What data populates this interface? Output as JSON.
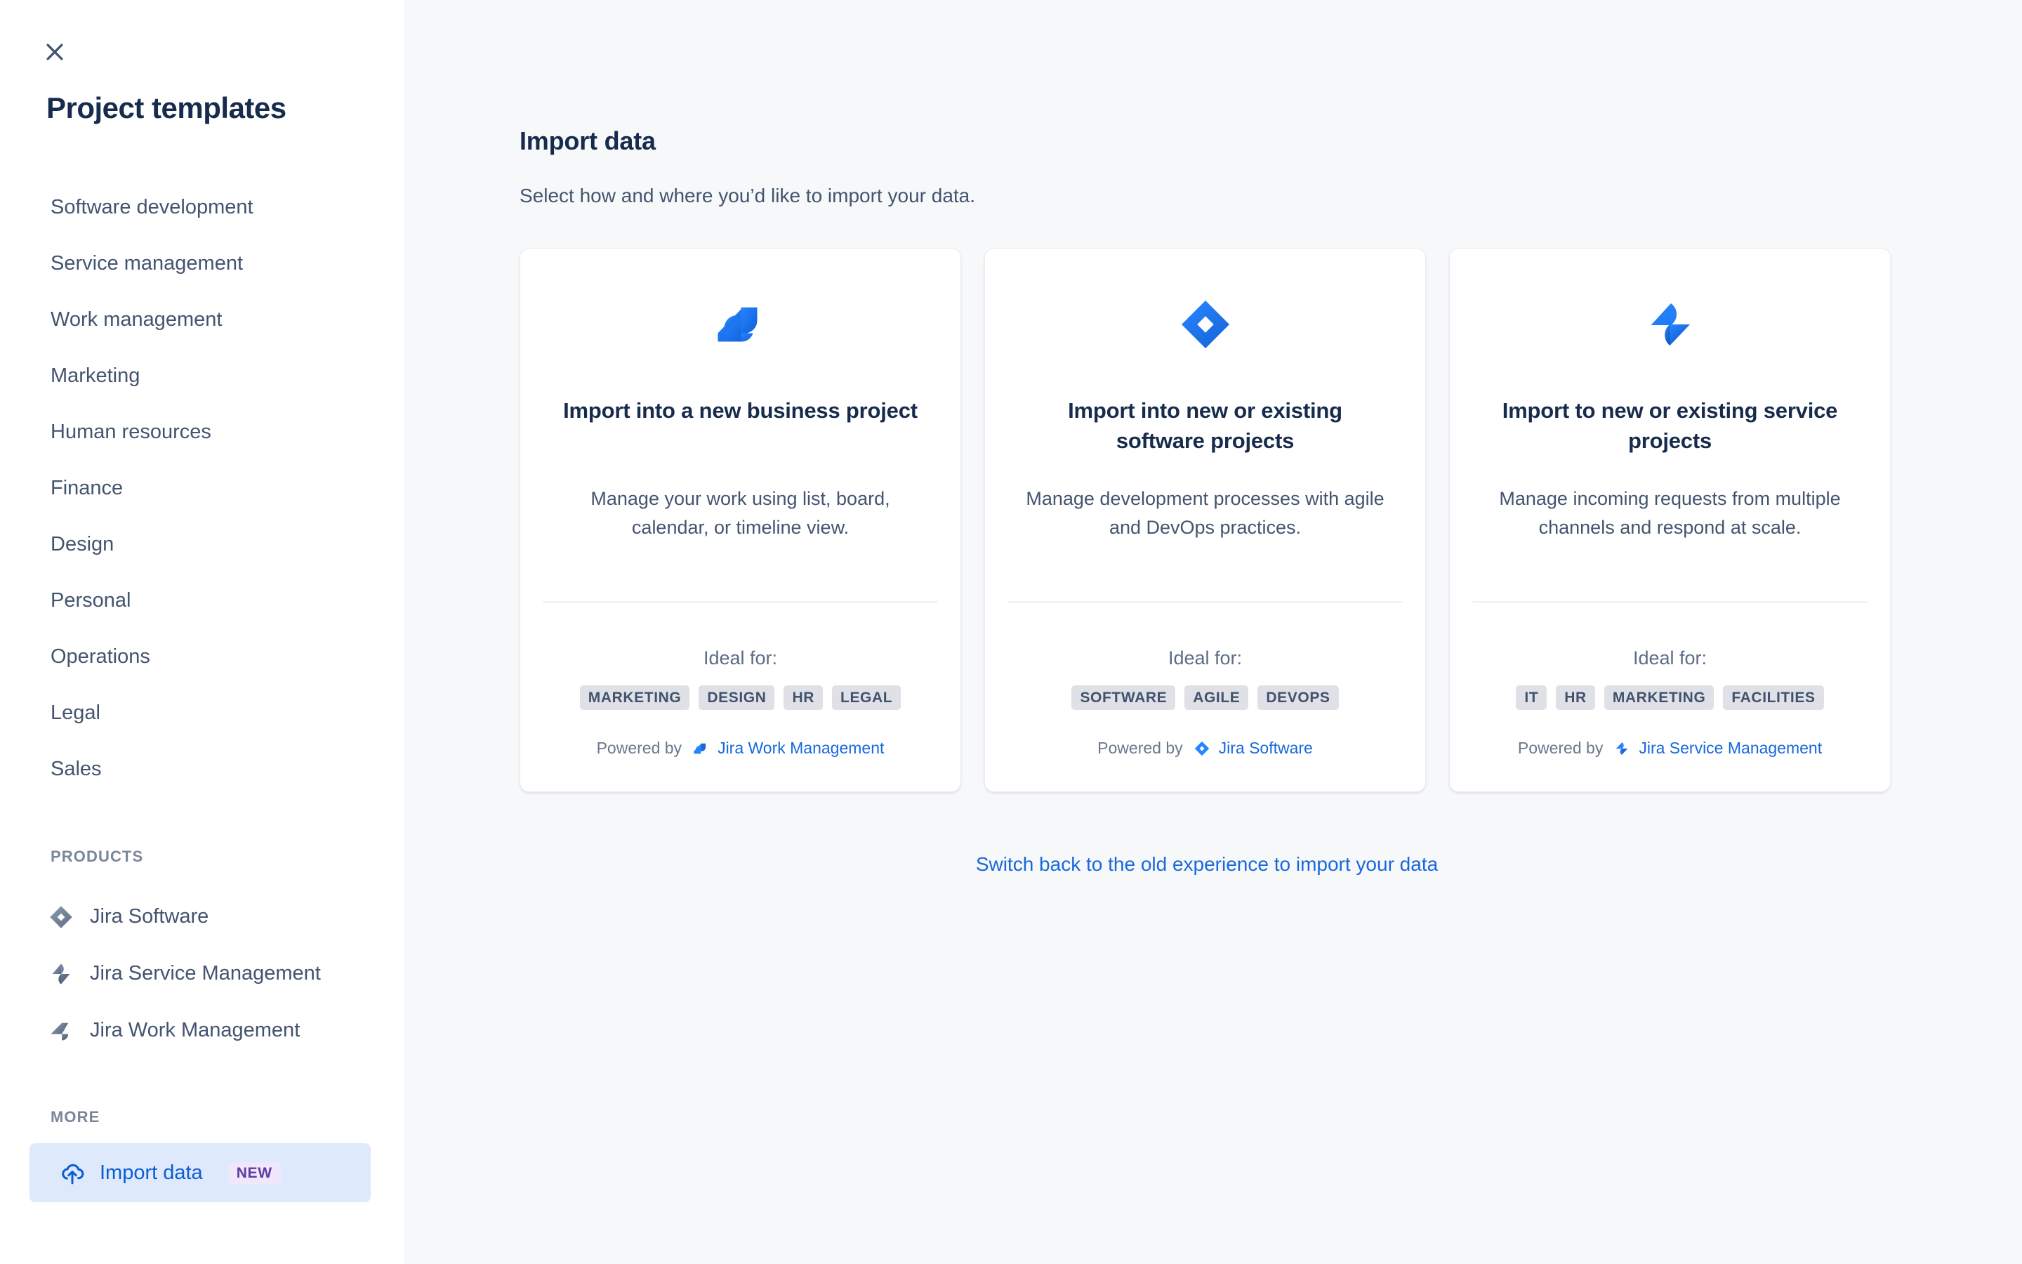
{
  "sidebar": {
    "close_icon": "close-icon",
    "title": "Project templates",
    "nav_items": [
      {
        "label": "Software development"
      },
      {
        "label": "Service management"
      },
      {
        "label": "Work management"
      },
      {
        "label": "Marketing"
      },
      {
        "label": "Human resources"
      },
      {
        "label": "Finance"
      },
      {
        "label": "Design"
      },
      {
        "label": "Personal"
      },
      {
        "label": "Operations"
      },
      {
        "label": "Legal"
      },
      {
        "label": "Sales"
      }
    ],
    "products_label": "PRODUCTS",
    "products": [
      {
        "label": "Jira Software",
        "icon": "jira-software-icon"
      },
      {
        "label": "Jira Service Management",
        "icon": "jira-service-management-icon"
      },
      {
        "label": "Jira Work Management",
        "icon": "jira-work-management-icon"
      }
    ],
    "more_label": "MORE",
    "more_item": {
      "label": "Import data",
      "badge": "NEW",
      "icon": "cloud-upload-icon"
    }
  },
  "main": {
    "title": "Import data",
    "subtitle": "Select how and where you’d like to import your data.",
    "ideal_for_label": "Ideal for:",
    "powered_by_label": "Powered by",
    "switch_link": "Switch back to the old experience to import your data",
    "cards": [
      {
        "logo": "jira-work-management-logo",
        "title": "Import into a new business project",
        "description": "Manage your work using list, board, calendar, or timeline view.",
        "tags": [
          "MARKETING",
          "DESIGN",
          "HR",
          "LEGAL"
        ],
        "powered_by": "Jira Work Management",
        "powered_icon": "jira-work-management-icon"
      },
      {
        "logo": "jira-software-logo",
        "title": "Import into new or existing software projects",
        "description": "Manage development processes with agile and DevOps practices.",
        "tags": [
          "SOFTWARE",
          "AGILE",
          "DEVOPS"
        ],
        "powered_by": "Jira Software",
        "powered_icon": "jira-software-icon"
      },
      {
        "logo": "jira-service-management-logo",
        "title": "Import to new or existing service projects",
        "description": "Manage incoming requests from multiple channels and respond at scale.",
        "tags": [
          "IT",
          "HR",
          "MARKETING",
          "FACILITIES"
        ],
        "powered_by": "Jira Service Management",
        "powered_icon": "jira-service-management-icon"
      }
    ]
  },
  "colors": {
    "brand_blue": "#1868DB",
    "logo_blue": "#2684FF",
    "text_dark": "#172B4D",
    "text_muted": "#44546F",
    "sidebar_bg": "#FFFFFF",
    "main_bg": "#F7F8FA",
    "tag_bg": "#DFE1E6",
    "selected_bg": "#DEE9FC",
    "new_badge_bg": "#EFE7FB",
    "new_badge_fg": "#5E3CA0"
  }
}
